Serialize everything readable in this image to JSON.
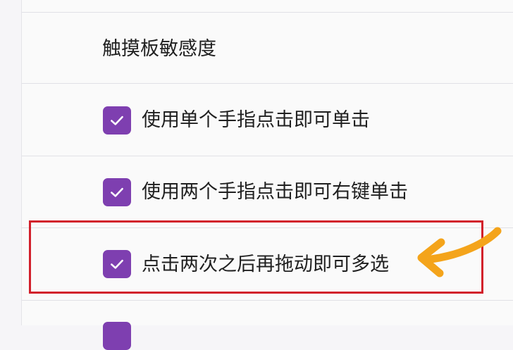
{
  "colors": {
    "accent": "#7e3fb0",
    "highlight": "#d2202b",
    "arrow": "#f4a41b"
  },
  "settings": {
    "section_title": "触摸板敏感度",
    "options": [
      {
        "label": "使用单个手指点击即可单击",
        "checked": true
      },
      {
        "label": "使用两个手指点击即可右键单击",
        "checked": true
      },
      {
        "label": "点击两次之后再拖动即可多选",
        "checked": true
      }
    ]
  }
}
